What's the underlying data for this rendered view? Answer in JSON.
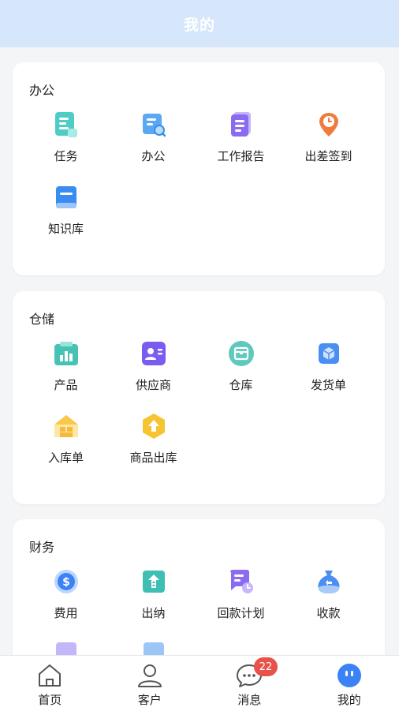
{
  "header": {
    "title": "我的"
  },
  "sections": [
    {
      "title": "办公",
      "items": [
        {
          "label": "任务",
          "icon": "task-icon"
        },
        {
          "label": "办公",
          "icon": "office-icon"
        },
        {
          "label": "工作报告",
          "icon": "report-icon"
        },
        {
          "label": "出差签到",
          "icon": "location-checkin-icon"
        },
        {
          "label": "知识库",
          "icon": "book-icon"
        }
      ]
    },
    {
      "title": "仓储",
      "items": [
        {
          "label": "产品",
          "icon": "product-chart-icon"
        },
        {
          "label": "供应商",
          "icon": "supplier-card-icon"
        },
        {
          "label": "仓库",
          "icon": "warehouse-box-icon"
        },
        {
          "label": "发货单",
          "icon": "shipping-cube-icon"
        },
        {
          "label": "入库单",
          "icon": "house-inbound-icon"
        },
        {
          "label": "商品出库",
          "icon": "outbound-arrow-icon"
        }
      ]
    },
    {
      "title": "财务",
      "items": [
        {
          "label": "费用",
          "icon": "dollar-coin-icon"
        },
        {
          "label": "出纳",
          "icon": "cashier-icon"
        },
        {
          "label": "回款计划",
          "icon": "payment-plan-icon"
        },
        {
          "label": "收款",
          "icon": "money-bag-icon"
        }
      ]
    }
  ],
  "tabbar": [
    {
      "label": "首页",
      "icon": "home-icon"
    },
    {
      "label": "客户",
      "icon": "customer-icon"
    },
    {
      "label": "消息",
      "icon": "message-icon",
      "badge": "22"
    },
    {
      "label": "我的",
      "icon": "profile-icon",
      "active": true
    }
  ],
  "colors": {
    "header_bg": "#d6e6fb",
    "badge": "#e8524a",
    "accent_blue": "#3b82f6"
  }
}
